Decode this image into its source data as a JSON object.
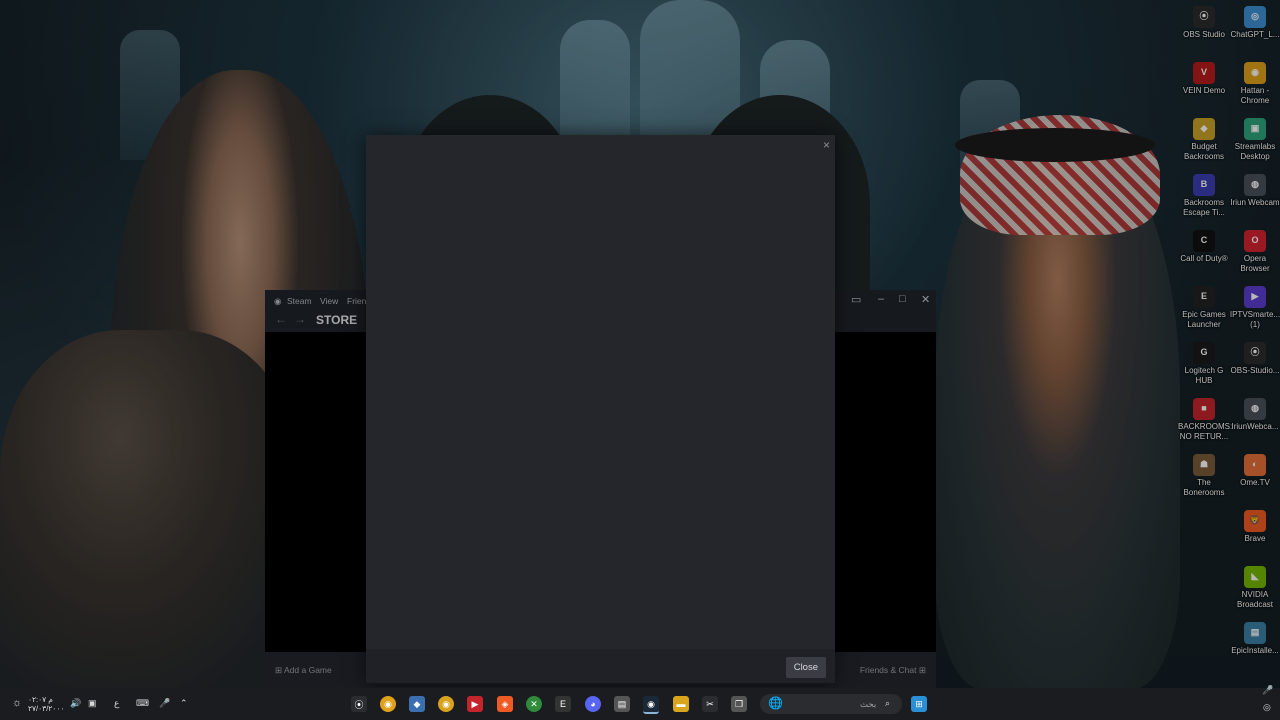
{
  "desktop_icons": [
    {
      "label": "OBS Studio",
      "color": "#2c2c2c",
      "glyph": "⦿"
    },
    {
      "label": "ChatGPT_L...",
      "color": "#3d8fd1",
      "glyph": "◎"
    },
    {
      "label": "VEIN Demo",
      "color": "#b71c1c",
      "glyph": "V"
    },
    {
      "label": "Hattan - Chrome",
      "color": "#e0a11b",
      "glyph": "◉"
    },
    {
      "label": "Budget Backrooms",
      "color": "#c9a227",
      "glyph": "◆"
    },
    {
      "label": "Streamlabs Desktop",
      "color": "#2fa37a",
      "glyph": "▣"
    },
    {
      "label": "Backrooms Escape Ti...",
      "color": "#3b3fb0",
      "glyph": "B"
    },
    {
      "label": "Iriun Webcam",
      "color": "#4a4f59",
      "glyph": "◍"
    },
    {
      "label": "Call of Duty®",
      "color": "#111111",
      "glyph": "C"
    },
    {
      "label": "Opera Browser",
      "color": "#d3232f",
      "glyph": "O"
    },
    {
      "label": "Epic Games Launcher",
      "color": "#222222",
      "glyph": "E"
    },
    {
      "label": "IPTVSmarte... (1)",
      "color": "#5b3ccf",
      "glyph": "▶"
    },
    {
      "label": "Logitech G HUB",
      "color": "#1a1a1a",
      "glyph": "G"
    },
    {
      "label": "OBS-Studio...",
      "color": "#2c2c2c",
      "glyph": "⦿"
    },
    {
      "label": "BACKROOMS: NO RETUR...",
      "color": "#c4242b",
      "glyph": "■"
    },
    {
      "label": "IriunWebca...",
      "color": "#4a4f59",
      "glyph": "◍"
    },
    {
      "label": "The Bonerooms",
      "color": "#7a5b3a",
      "glyph": "☗"
    },
    {
      "label": "Ome.TV",
      "color": "#e66f3b",
      "glyph": "◐"
    },
    {
      "label": "Brave",
      "color": "#f05a24",
      "glyph": "🦁"
    },
    {
      "label": "NVIDIA Broadcast",
      "color": "#76b900",
      "glyph": "◣"
    },
    {
      "label": "EpicInstalle...",
      "color": "#3b7fa6",
      "glyph": "▤"
    }
  ],
  "steam": {
    "menu": [
      "Steam",
      "View",
      "Frien"
    ],
    "store_label": "STORE",
    "add_game": "Add a Game",
    "friends_chat": "Friends & Chat"
  },
  "modal": {
    "close_button": "Close",
    "close_x": "×"
  },
  "taskbar": {
    "clock_line1": "م ٠٢:٠٧",
    "clock_line2": "٢٧/٠٣/٢٠٠٠",
    "lang": "ع",
    "search_placeholder": "بحث"
  }
}
